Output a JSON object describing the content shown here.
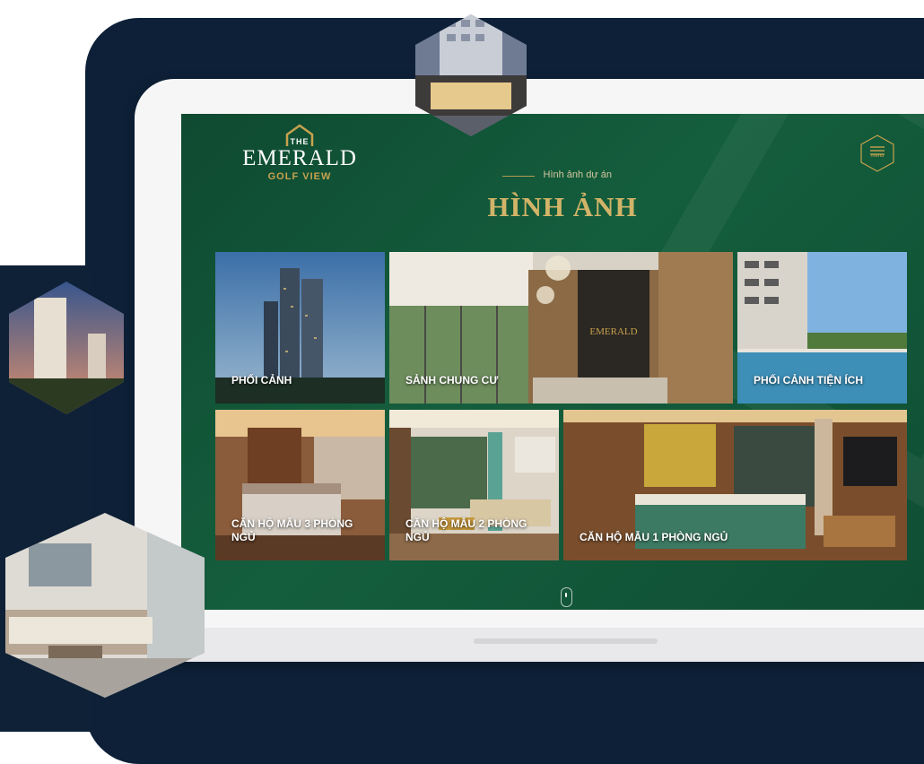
{
  "brand": {
    "the": "THE",
    "name": "EMERALD",
    "tagline": "GOLF VIEW"
  },
  "menu": {
    "label": "menu"
  },
  "section": {
    "subtitle": "Hình ảnh dự án",
    "title": "HÌNH ẢNH"
  },
  "gallery": [
    {
      "label": "PHỐI CẢNH"
    },
    {
      "label": "SẢNH CHUNG CƯ"
    },
    {
      "label": "PHỐI CẢNH TIỆN ÍCH"
    },
    {
      "label": "CĂN HỘ MẪU 3 PHÒNG NGỦ"
    },
    {
      "label": "CĂN HỘ MẪU 2 PHÒNG NGỦ"
    },
    {
      "label": "CĂN HỘ MẪU 1 PHÒNG NGỦ"
    }
  ],
  "colors": {
    "screen_bg": "#145e3d",
    "gold": "#c8a24e",
    "navy": "#0d2037"
  },
  "lobby_sign": "EMERALD"
}
